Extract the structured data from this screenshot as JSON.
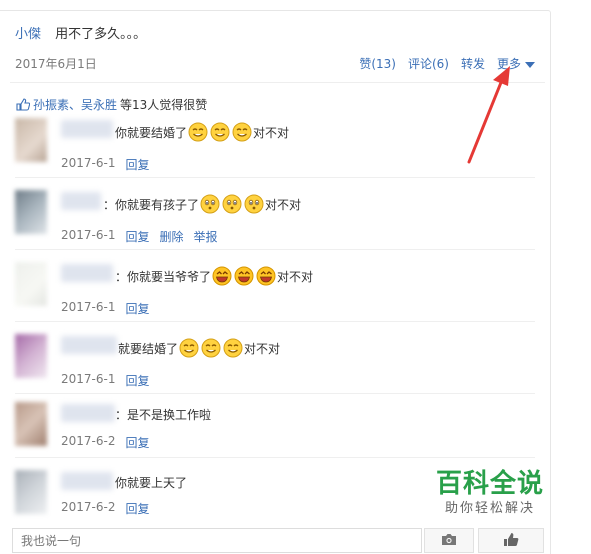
{
  "post": {
    "author": "小傑",
    "text": "用不了多久。。。",
    "date": "2017年6月1日",
    "actions": {
      "like": "赞(13)",
      "comment": "评论(6)",
      "forward": "转发",
      "more": "更多"
    }
  },
  "likes": {
    "names": "孙振素、吴永胜",
    "suffix": "等13人觉得很赞"
  },
  "comments": [
    {
      "text_before": "你就要结婚了",
      "text_after": "对不对",
      "emoji": "grin",
      "date": "2017-6-1",
      "actions": [
        "回复"
      ]
    },
    {
      "text_before": "：你就要有孩子了",
      "text_after": "对不对",
      "emoji": "blush",
      "date": "2017-6-1",
      "actions": [
        "回复",
        "删除",
        "举报"
      ]
    },
    {
      "text_before": "：你就要当爷爷了",
      "text_after": "对不对",
      "emoji": "laugh",
      "date": "2017-6-1",
      "actions": [
        "回复"
      ]
    },
    {
      "text_before": "就要结婚了",
      "text_after": "对不对",
      "emoji": "grin",
      "date": "2017-6-1",
      "actions": [
        "回复"
      ]
    },
    {
      "text_before": "：是不是换工作啦",
      "text_after": "",
      "emoji": "",
      "date": "2017-6-2",
      "actions": [
        "回复"
      ]
    },
    {
      "text_before": "你就要上天了",
      "text_after": "",
      "emoji": "",
      "date": "2017-6-2",
      "actions": [
        "回复"
      ]
    }
  ],
  "reply": {
    "placeholder": "我也说一句"
  },
  "watermark": {
    "title": "百科全说",
    "subtitle": "助你轻松解决"
  },
  "colors": {
    "link": "#3b6fb6",
    "arrow": "#e53935",
    "watermark": "#29a04a"
  }
}
